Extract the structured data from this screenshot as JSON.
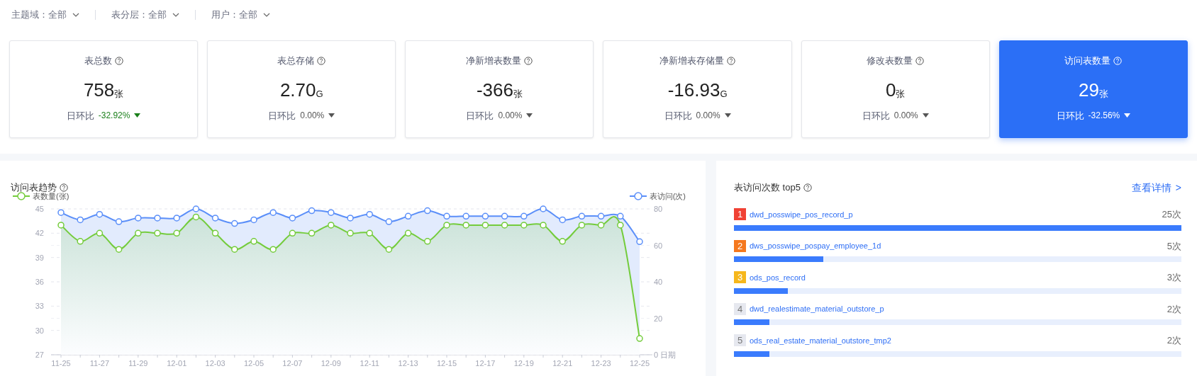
{
  "filters": [
    {
      "label": "主题域：",
      "value": "全部"
    },
    {
      "label": "表分层：",
      "value": "全部"
    },
    {
      "label": "用户：",
      "value": "全部"
    }
  ],
  "cards": [
    {
      "title": "表总数",
      "value": "758",
      "unit": "张",
      "change_label": "日环比",
      "change": "-32.92%",
      "change_emphasized": true,
      "selected": false
    },
    {
      "title": "表总存储",
      "value": "2.70",
      "unit": "G",
      "change_label": "日环比",
      "change": "0.00%",
      "change_emphasized": false,
      "selected": false
    },
    {
      "title": "净新增表数量",
      "value": "-366",
      "unit": "张",
      "change_label": "日环比",
      "change": "0.00%",
      "change_emphasized": false,
      "selected": false
    },
    {
      "title": "净新增表存储量",
      "value": "-16.93",
      "unit": "G",
      "change_label": "日环比",
      "change": "0.00%",
      "change_emphasized": false,
      "selected": false
    },
    {
      "title": "修改表数量",
      "value": "0",
      "unit": "张",
      "change_label": "日环比",
      "change": "0.00%",
      "change_emphasized": false,
      "selected": false
    },
    {
      "title": "访问表数量",
      "value": "29",
      "unit": "张",
      "change_label": "日环比",
      "change": "-32.56%",
      "change_emphasized": false,
      "selected": true
    }
  ],
  "trend": {
    "title": "访问表趋势",
    "chart_data": {
      "type": "line",
      "xlabel": "日期",
      "categories": [
        "11-25",
        null,
        "11-27",
        null,
        "11-29",
        null,
        "12-01",
        null,
        "12-03",
        null,
        "12-05",
        null,
        "12-07",
        null,
        "12-09",
        null,
        "12-11",
        null,
        "12-13",
        null,
        "12-15",
        null,
        "12-17",
        null,
        "12-19",
        null,
        "12-21",
        null,
        "12-23",
        null,
        "12-25"
      ],
      "series": [
        {
          "name": "表数量(张)",
          "color": "#74cc3c",
          "marker": "circle",
          "values": [
            43,
            41,
            42,
            40,
            42,
            42,
            42,
            44,
            42,
            40,
            41,
            40,
            42,
            42,
            43,
            42,
            42,
            40,
            42,
            41,
            43,
            43,
            43,
            43,
            43,
            43,
            41,
            43,
            43,
            43,
            29
          ]
        },
        {
          "name": "表访问(次)",
          "color": "#5b8ff9",
          "axis": "y2",
          "marker": "circle",
          "values": [
            78,
            74,
            77,
            73,
            75,
            75,
            75,
            80,
            75,
            72,
            74,
            78,
            75,
            79,
            78,
            75,
            77,
            73,
            76,
            79,
            76,
            76,
            76,
            76,
            76,
            80,
            74,
            76,
            76,
            76,
            62
          ]
        }
      ],
      "grid": true,
      "ylim": [
        27,
        45
      ],
      "yticks": [
        27,
        30,
        33,
        36,
        39,
        42,
        45
      ],
      "y2lim": [
        0,
        80
      ],
      "y2ticks": [
        0,
        20,
        40,
        60,
        80
      ]
    }
  },
  "top5": {
    "title": "表访问次数 top5",
    "link": "查看详情",
    "link_icon": ">",
    "rows": [
      {
        "rank": "1",
        "color": "#f04134",
        "name": "dwd_posswipe_pos_record_p",
        "count": "25次",
        "level": 1
      },
      {
        "rank": "2",
        "color": "#f5781e",
        "name": "dws_posswipe_pospay_employee_1d",
        "count": "5次",
        "level": 0.2
      },
      {
        "rank": "3",
        "color": "#f6b71c",
        "name": "ods_pos_record",
        "count": "3次",
        "level": 0.12
      },
      {
        "rank": "4",
        "color": "#e6e8ef",
        "name": "dwd_realestimate_material_outstore_p",
        "count": "2次",
        "level": 0.08
      },
      {
        "rank": "5",
        "color": "#e6e8ef",
        "name": "ods_real_estate_material_outstore_tmp2",
        "count": "2次",
        "level": 0.08
      }
    ]
  }
}
